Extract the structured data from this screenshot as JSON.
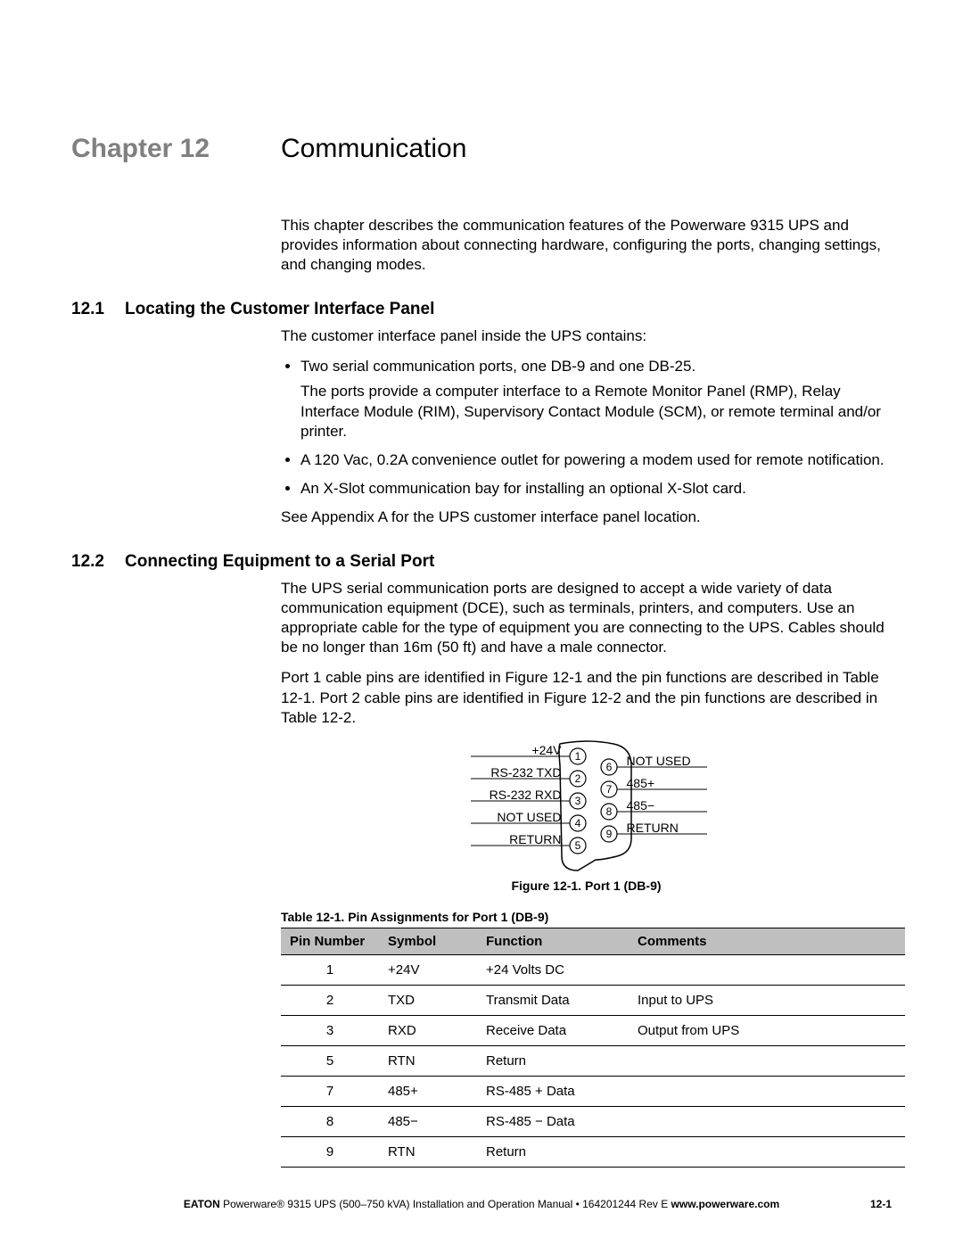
{
  "chapter": {
    "label": "Chapter 12",
    "title": "Communication"
  },
  "intro": "This chapter describes the communication features of the Powerware 9315 UPS and provides information about connecting hardware, configuring the ports, changing settings, and changing modes.",
  "s121": {
    "num": "12.1",
    "title": "Locating the Customer Interface Panel",
    "lead": "The customer interface panel inside the UPS contains:",
    "b1": "Two serial communication ports, one DB-9 and one DB-25.",
    "b1sub": "The ports provide a computer interface to a Remote Monitor Panel (RMP), Relay Interface Module (RIM), Supervisory Contact Module (SCM), or remote terminal and/or printer.",
    "b2": "A 120 Vac, 0.2A convenience outlet for powering a modem used for remote notification.",
    "b3": "An X-Slot communication bay for installing an optional X-Slot card.",
    "tail": "See Appendix A for the UPS customer interface panel location."
  },
  "s122": {
    "num": "12.2",
    "title": "Connecting Equipment to a Serial Port",
    "p1": "The UPS serial communication ports are designed to accept a wide variety of data communication equipment (DCE), such as terminals, printers, and computers. Use an appropriate cable for the type of equipment you are connecting to the UPS. Cables should be no longer than 16m (50 ft) and have a male connector.",
    "p2": "Port 1 cable pins are identified in Figure 12-1 and the pin functions are described in Table 12-1. Port 2 cable pins are identified in Figure 12-2 and the pin functions are described in Table 12-2."
  },
  "figure": {
    "caption": "Figure 12-1. Port 1 (DB-9)",
    "left": {
      "p1": "+24V",
      "p2": "RS-232 TXD",
      "p3": "RS-232 RXD",
      "p4": "NOT USED",
      "p5": "RETURN"
    },
    "right": {
      "p6": "NOT USED",
      "p7": "485+",
      "p8": "485−",
      "p9": "RETURN"
    }
  },
  "table": {
    "caption": "Table 12-1. Pin Assignments for Port 1 (DB-9)",
    "headers": {
      "c1": "Pin Number",
      "c2": "Symbol",
      "c3": "Function",
      "c4": "Comments"
    },
    "rows": [
      {
        "pin": "1",
        "sym": "+24V",
        "fn": "+24 Volts DC",
        "cm": ""
      },
      {
        "pin": "2",
        "sym": "TXD",
        "fn": "Transmit Data",
        "cm": "Input to UPS"
      },
      {
        "pin": "3",
        "sym": "RXD",
        "fn": "Receive Data",
        "cm": "Output from UPS"
      },
      {
        "pin": "5",
        "sym": "RTN",
        "fn": "Return",
        "cm": ""
      },
      {
        "pin": "7",
        "sym": "485+",
        "fn": "RS-485 + Data",
        "cm": ""
      },
      {
        "pin": "8",
        "sym": "485−",
        "fn": "RS-485 − Data",
        "cm": ""
      },
      {
        "pin": "9",
        "sym": "RTN",
        "fn": "Return",
        "cm": ""
      }
    ]
  },
  "footer": {
    "brand": "EATON",
    "text": " Powerware® 9315 UPS (500–750 kVA) Installation and Operation Manual  •  164201244 Rev E ",
    "url": "www.powerware.com",
    "page": "12-1"
  }
}
